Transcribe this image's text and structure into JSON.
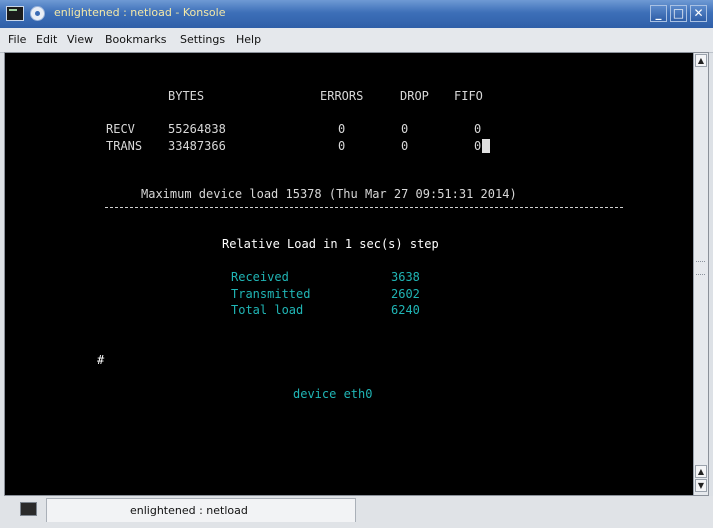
{
  "window": {
    "title": "enlightened : netload - Konsole",
    "buttons": {
      "minimize": "_",
      "maximize": "□",
      "close": "✕"
    }
  },
  "menubar": {
    "file": "File",
    "edit": "Edit",
    "view": "View",
    "bookmarks": "Bookmarks",
    "settings": "Settings",
    "help": "Help"
  },
  "terminal": {
    "header": {
      "bytes": "BYTES",
      "errors": "ERRORS",
      "drop": "DROP",
      "fifo": "FIFO"
    },
    "recv": {
      "label": "RECV",
      "bytes": "55264838",
      "errors": "0",
      "drop": "0",
      "fifo": "0"
    },
    "trans": {
      "label": "TRANS",
      "bytes": "33487366",
      "errors": "0",
      "drop": "0",
      "fifo": "0"
    },
    "max_load": "Maximum device load 15378 (Thu Mar 27 09:51:31 2014)",
    "relative_load": "Relative Load in 1 sec(s) step",
    "stats": [
      {
        "label": "Received",
        "value": "3638"
      },
      {
        "label": "Transmitted",
        "value": "2602"
      },
      {
        "label": "Total load",
        "value": "6240"
      }
    ],
    "prompt": "#",
    "device": "device eth0"
  },
  "scrollbar": {
    "up": "▲",
    "down": "▼"
  },
  "tabs": [
    {
      "label": "enlightened : netload"
    }
  ],
  "icons": [
    "konsole-icon",
    "window-menu-icon",
    "terminal-tab-icon",
    "scroll-up-icon",
    "scroll-down-icon"
  ]
}
